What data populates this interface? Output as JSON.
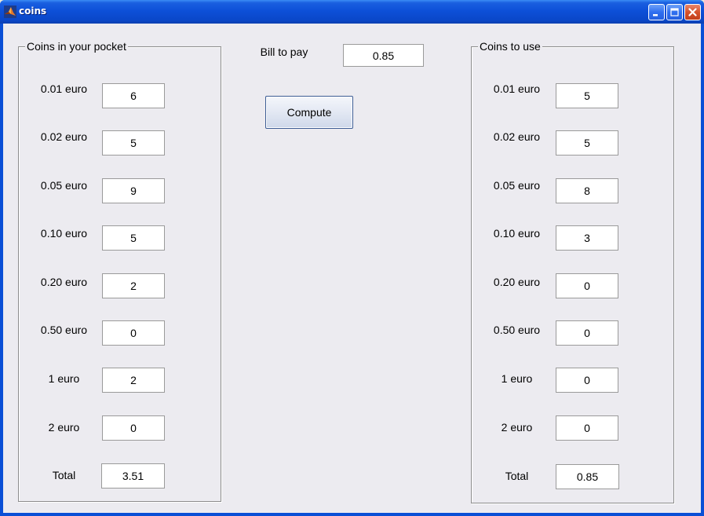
{
  "window": {
    "title": "coins"
  },
  "left_panel": {
    "title": "Coins in your pocket",
    "rows": [
      {
        "label": "0.01 euro",
        "value": "6"
      },
      {
        "label": "0.02 euro",
        "value": "5"
      },
      {
        "label": "0.05 euro",
        "value": "9"
      },
      {
        "label": "0.10 euro",
        "value": "5"
      },
      {
        "label": "0.20 euro",
        "value": "2"
      },
      {
        "label": "0.50 euro",
        "value": "0"
      },
      {
        "label": "1 euro",
        "value": "2"
      },
      {
        "label": "2 euro",
        "value": "0"
      }
    ],
    "total_label": "Total",
    "total_value": "3.51"
  },
  "center": {
    "bill_label": "Bill to pay",
    "bill_value": "0.85",
    "compute_label": "Compute"
  },
  "right_panel": {
    "title": "Coins to use",
    "rows": [
      {
        "label": "0.01 euro",
        "value": "5"
      },
      {
        "label": "0.02 euro",
        "value": "5"
      },
      {
        "label": "0.05 euro",
        "value": "8"
      },
      {
        "label": "0.10 euro",
        "value": "3"
      },
      {
        "label": "0.20 euro",
        "value": "0"
      },
      {
        "label": "0.50 euro",
        "value": "0"
      },
      {
        "label": "1 euro",
        "value": "0"
      },
      {
        "label": "2 euro",
        "value": "0"
      }
    ],
    "total_label": "Total",
    "total_value": "0.85"
  }
}
